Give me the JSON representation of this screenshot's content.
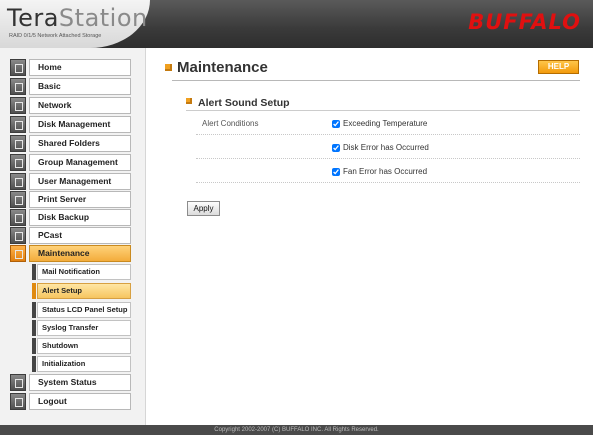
{
  "header": {
    "logo_dark": "Tera",
    "logo_light": "Station",
    "subtitle": "RAID 0/1/5 Network Attached Storage",
    "brand": "BUFFALO"
  },
  "colors": {
    "accent": "#f0a020",
    "active_nav": "#f3ac3c",
    "brand_red": "#e01010",
    "header_bg": "#3a3a3a"
  },
  "nav": {
    "items": [
      {
        "label": "Home",
        "icon": "home-icon"
      },
      {
        "label": "Basic",
        "icon": "basic-icon"
      },
      {
        "label": "Network",
        "icon": "network-icon"
      },
      {
        "label": "Disk Management",
        "icon": "disk-icon"
      },
      {
        "label": "Shared Folders",
        "icon": "folder-icon"
      },
      {
        "label": "Group Management",
        "icon": "group-icon"
      },
      {
        "label": "User Management",
        "icon": "user-icon"
      },
      {
        "label": "Print Server",
        "icon": "printer-icon"
      },
      {
        "label": "Disk Backup",
        "icon": "backup-icon"
      },
      {
        "label": "PCast",
        "icon": "pcast-icon"
      },
      {
        "label": "Maintenance",
        "icon": "tools-icon"
      }
    ],
    "sub_items": [
      {
        "label": "Mail Notification"
      },
      {
        "label": "Alert Setup"
      },
      {
        "label": "Status LCD Panel Setup"
      },
      {
        "label": "Syslog Transfer"
      },
      {
        "label": "Shutdown"
      },
      {
        "label": "Initialization"
      }
    ],
    "bottom_items": [
      {
        "label": "System Status",
        "icon": "status-icon"
      },
      {
        "label": "Logout",
        "icon": "logout-icon"
      }
    ]
  },
  "main": {
    "title": "Maintenance",
    "help_label": "HELP",
    "section_title": "Alert Sound Setup",
    "field_label": "Alert Conditions",
    "conditions": [
      {
        "label": "Exceeding Temperature",
        "checked": true
      },
      {
        "label": "Disk Error has Occurred",
        "checked": true
      },
      {
        "label": "Fan Error has Occurred",
        "checked": true
      }
    ],
    "apply_label": "Apply"
  },
  "footer": {
    "copyright": "Copyright 2002-2007 (C) BUFFALO INC. All Rights Reserved."
  }
}
